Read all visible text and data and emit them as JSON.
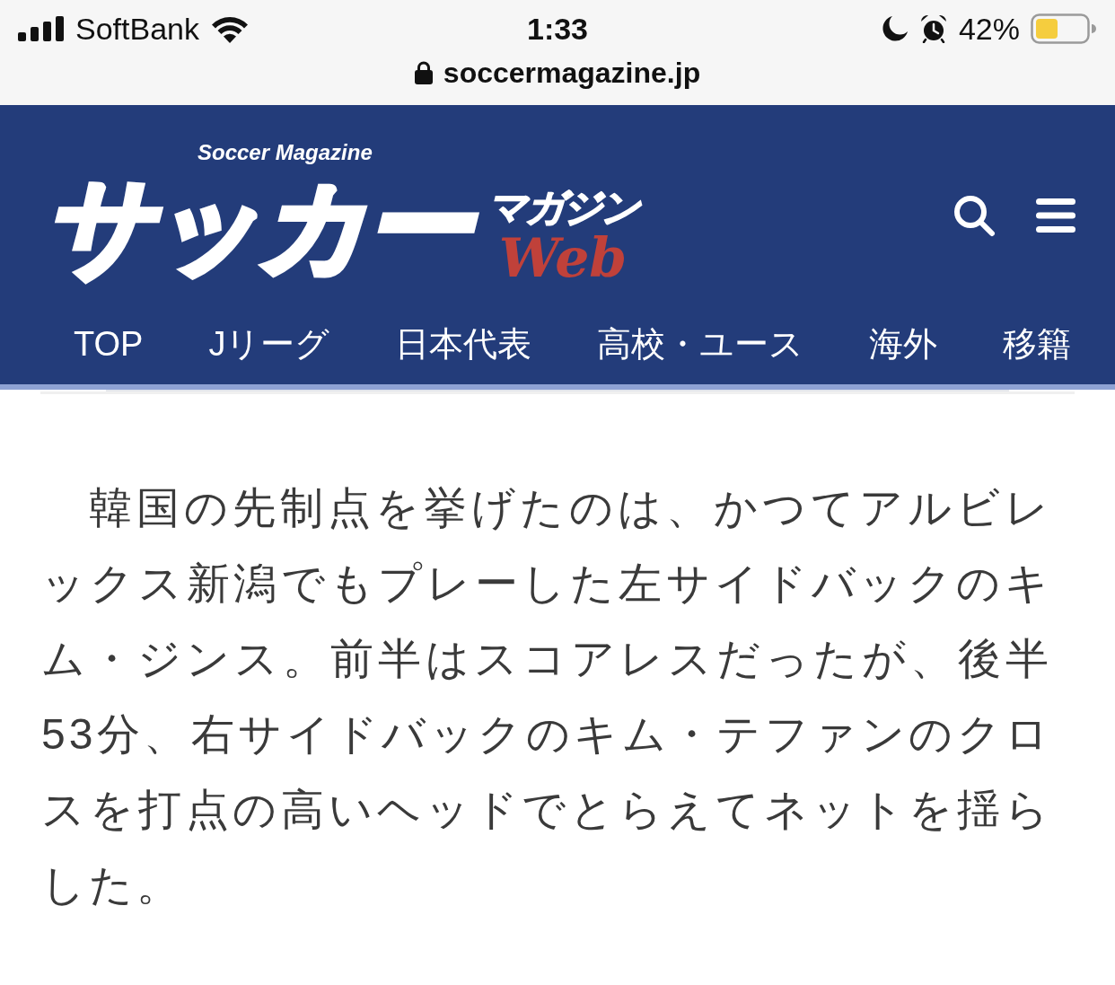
{
  "status_bar": {
    "carrier": "SoftBank",
    "time": "1:33",
    "battery_percent": "42%"
  },
  "address_bar": {
    "url": "soccermagazine.jp"
  },
  "header": {
    "logo": {
      "tagline": "Soccer Magazine",
      "title": "サッカー",
      "subtitle": "マガジン",
      "edition": "Web"
    }
  },
  "nav": {
    "items": [
      {
        "label": "TOP"
      },
      {
        "label": "Jリーグ"
      },
      {
        "label": "日本代表"
      },
      {
        "label": "高校・ユース"
      },
      {
        "label": "海外"
      },
      {
        "label": "移籍"
      }
    ]
  },
  "article": {
    "paragraph": "韓国の先制点を挙げたのは、かつてアルビレックス新潟でもプレーした左サイドバックのキム・ジンス。前半はスコアレスだったが、後半53分、右サイドバックのキム・テファンのクロスを打点の高いヘッドでとらえてネットを揺らした。"
  }
}
